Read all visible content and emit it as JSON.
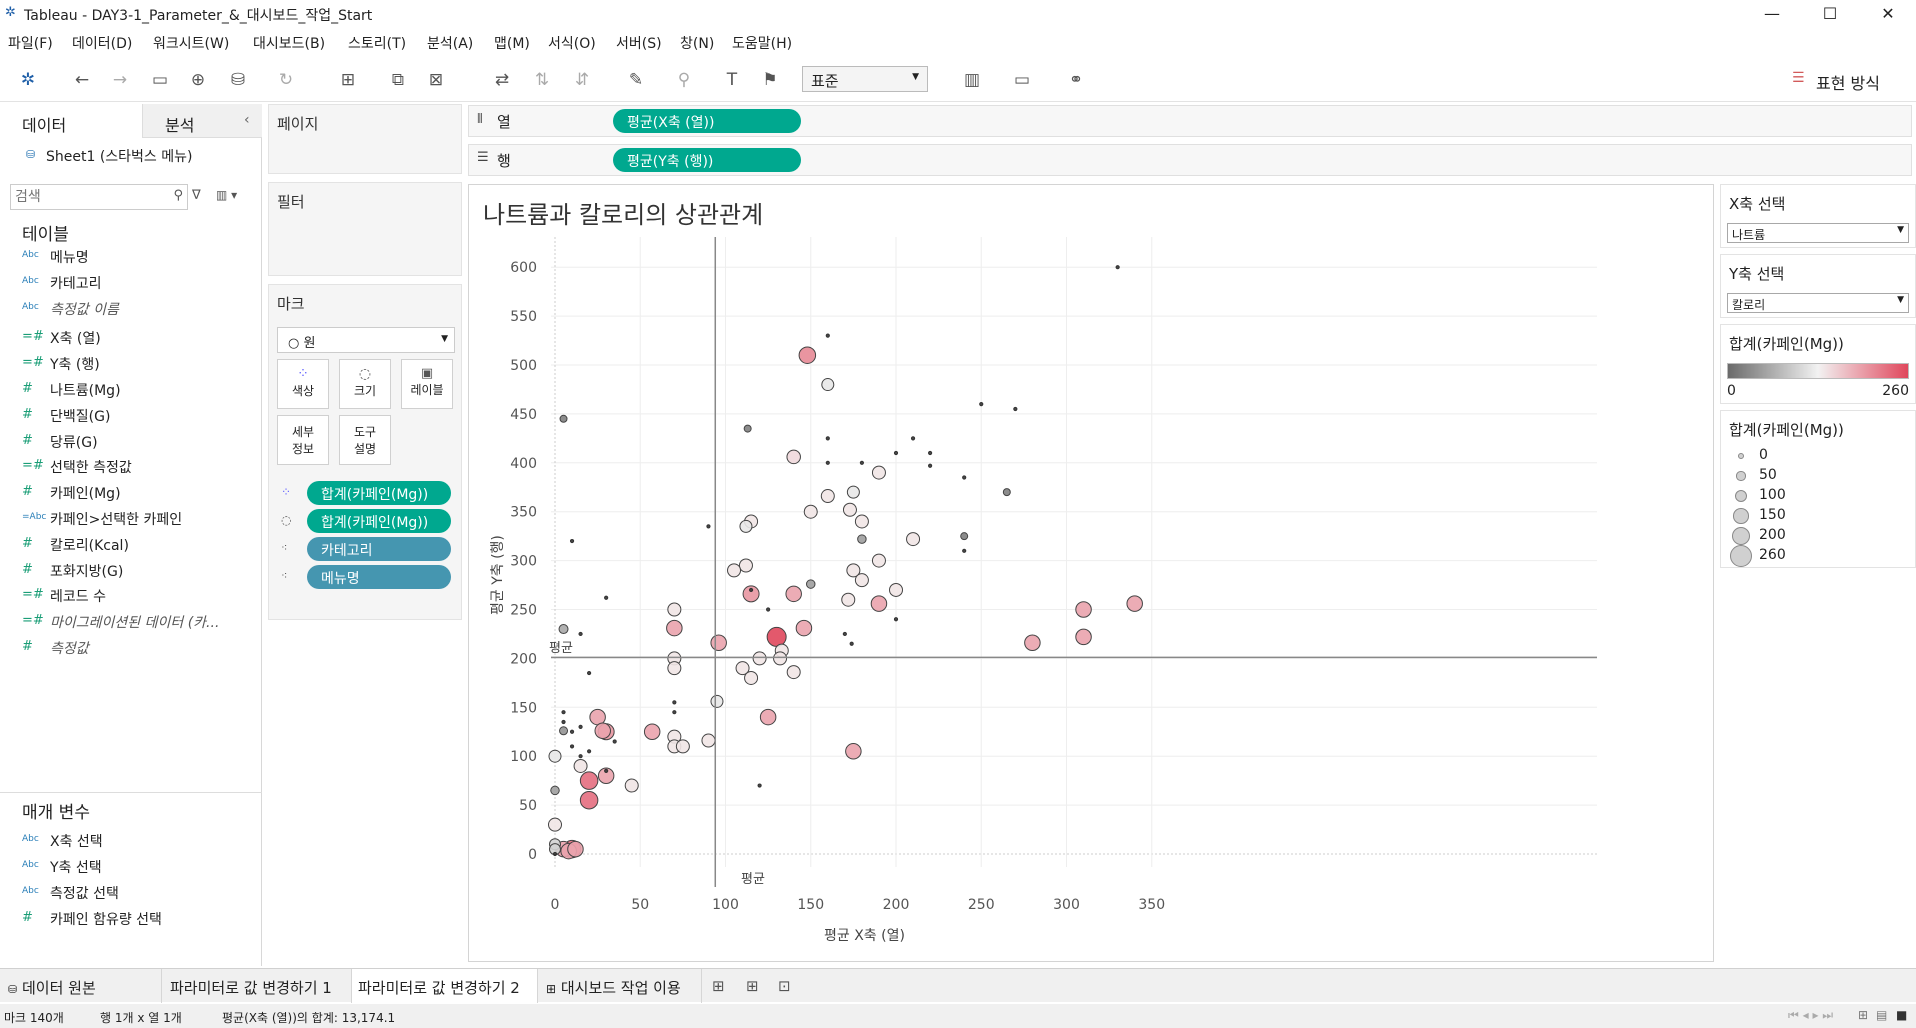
{
  "window": {
    "title": "Tableau - DAY3-1_Parameter_&_대시보드_작업_Start",
    "minimize_glyph": "—",
    "maximize_glyph": "☐",
    "close_glyph": "✕"
  },
  "menu": [
    "파일(F)",
    "데이터(D)",
    "워크시트(W)",
    "대시보드(B)",
    "스토리(T)",
    "분석(A)",
    "맵(M)",
    "서식(O)",
    "서버(S)",
    "창(N)",
    "도움말(H)"
  ],
  "toolbar": {
    "fit_value": "표준",
    "show_me_label": "표현 방식"
  },
  "sidebar": {
    "tab_data": "데이터",
    "tab_analysis": "분석",
    "datasource": "Sheet1 (스타벅스 메뉴)",
    "search_placeholder": "검색",
    "tables_title": "테이블",
    "fields": [
      {
        "type": "Abc",
        "label": "메뉴명",
        "italic": false
      },
      {
        "type": "Abc",
        "label": "카테고리",
        "italic": false
      },
      {
        "type": "Abc",
        "label": "측정값 이름",
        "italic": true
      },
      {
        "type": "=#",
        "label": "X축 (열)",
        "italic": false
      },
      {
        "type": "=#",
        "label": "Y축 (행)",
        "italic": false
      },
      {
        "type": "#",
        "label": "나트륨(Mg)",
        "italic": false
      },
      {
        "type": "#",
        "label": "단백질(G)",
        "italic": false
      },
      {
        "type": "#",
        "label": "당류(G)",
        "italic": false
      },
      {
        "type": "=#",
        "label": "선택한 측정값",
        "italic": false
      },
      {
        "type": "#",
        "label": "카페인(Mg)",
        "italic": false
      },
      {
        "type": "=Abc",
        "label": "카페인>선택한 카페인",
        "italic": false
      },
      {
        "type": "#",
        "label": "칼로리(Kcal)",
        "italic": false
      },
      {
        "type": "#",
        "label": "포화지방(G)",
        "italic": false
      },
      {
        "type": "=#",
        "label": "레코드 수",
        "italic": false
      },
      {
        "type": "=#",
        "label": "마이그레이션된 데이터 (카...",
        "italic": true
      },
      {
        "type": "#",
        "label": "측정값",
        "italic": true
      }
    ],
    "params_title": "매개 변수",
    "params": [
      {
        "type": "Abc",
        "label": "X축 선택"
      },
      {
        "type": "Abc",
        "label": "Y축 선택"
      },
      {
        "type": "Abc",
        "label": "측정값 선택"
      },
      {
        "type": "#",
        "label": "카페인 함유량 선택"
      }
    ]
  },
  "shelves": {
    "pages": "페이지",
    "filters": "필터",
    "marks": "마크",
    "mark_type": "○ 원",
    "mark_buttons": [
      {
        "name": "color",
        "label": "색상"
      },
      {
        "name": "size",
        "label": "크기"
      },
      {
        "name": "label",
        "label": "레이블"
      },
      {
        "name": "detail",
        "label": "세부\n정보"
      },
      {
        "name": "tooltip",
        "label": "도구\n설명"
      }
    ],
    "mark_pills": [
      "합계(카페인(Mg))",
      "합계(카페인(Mg))",
      "카테고리",
      "메뉴명"
    ],
    "columns_label": "열",
    "rows_label": "행",
    "columns_pill": "평균(X축 (열))",
    "rows_pill": "평균(Y축 (행))"
  },
  "view": {
    "title": "나트륨과 칼로리의 상관관계",
    "avg_label_h": "평균",
    "avg_label_v": "평균"
  },
  "right_panel": {
    "x_param_title": "X축 선택",
    "x_param_value": "나트륨",
    "y_param_title": "Y축 선택",
    "y_param_value": "칼로리",
    "color_legend_title": "합계(카페인(Mg))",
    "color_min": "0",
    "color_max": "260",
    "size_legend_title": "합계(카페인(Mg))",
    "size_items": [
      "0",
      "50",
      "100",
      "150",
      "200",
      "260"
    ],
    "colors": {
      "low": "#6a6a6a",
      "mid": "#f2f2f2",
      "high": "#e0475c"
    }
  },
  "bottom_tabs": [
    "데이터 원본",
    "파라미터로 값 변경하기 1",
    "파라미터로 값 변경하기 2",
    "대시보드 작업 이용"
  ],
  "status": {
    "marks": "마크 140개",
    "rows_cols": "행 1개 x 열 1개",
    "sum": "평균(X축 (열))의 합계: 13,174.1"
  },
  "chart_data": {
    "type": "scatter",
    "title": "나트륨과 칼로리의 상관관계",
    "xlabel": "평균 X축 (열)",
    "ylabel": "평균 Y축 (행)",
    "xlim": [
      -20,
      365
    ],
    "ylim": [
      -40,
      620
    ],
    "xticks": [
      0,
      50,
      100,
      150,
      200,
      250,
      300,
      350
    ],
    "yticks": [
      0,
      50,
      100,
      150,
      200,
      250,
      300,
      350,
      400,
      450,
      500,
      550,
      600
    ],
    "avg_x": 94,
    "avg_y": 201,
    "points": [
      {
        "x": 330,
        "y": 600,
        "c": 0
      },
      {
        "x": 160,
        "y": 530,
        "c": 0
      },
      {
        "x": 148,
        "y": 510,
        "c": 210
      },
      {
        "x": 160,
        "y": 480,
        "c": 120
      },
      {
        "x": 250,
        "y": 460,
        "c": 0
      },
      {
        "x": 270,
        "y": 455,
        "c": 0
      },
      {
        "x": 5,
        "y": 445,
        "c": 20
      },
      {
        "x": 113,
        "y": 435,
        "c": 20
      },
      {
        "x": 160,
        "y": 425,
        "c": 0
      },
      {
        "x": 210,
        "y": 425,
        "c": 0
      },
      {
        "x": 200,
        "y": 410,
        "c": 0
      },
      {
        "x": 220,
        "y": 410,
        "c": 0
      },
      {
        "x": 140,
        "y": 406,
        "c": 150
      },
      {
        "x": 160,
        "y": 400,
        "c": 0
      },
      {
        "x": 180,
        "y": 400,
        "c": 0
      },
      {
        "x": 220,
        "y": 397,
        "c": 0
      },
      {
        "x": 190,
        "y": 390,
        "c": 140
      },
      {
        "x": 240,
        "y": 385,
        "c": 0
      },
      {
        "x": 265,
        "y": 370,
        "c": 20
      },
      {
        "x": 175,
        "y": 370,
        "c": 120
      },
      {
        "x": 160,
        "y": 366,
        "c": 140
      },
      {
        "x": 150,
        "y": 350,
        "c": 140
      },
      {
        "x": 173,
        "y": 352,
        "c": 140
      },
      {
        "x": 115,
        "y": 340,
        "c": 140
      },
      {
        "x": 180,
        "y": 340,
        "c": 140
      },
      {
        "x": 112,
        "y": 335,
        "c": 120
      },
      {
        "x": 90,
        "y": 335,
        "c": 0
      },
      {
        "x": 240,
        "y": 325,
        "c": 20
      },
      {
        "x": 210,
        "y": 322,
        "c": 140
      },
      {
        "x": 180,
        "y": 322,
        "c": 50
      },
      {
        "x": 10,
        "y": 320,
        "c": 0
      },
      {
        "x": 240,
        "y": 310,
        "c": 0
      },
      {
        "x": 190,
        "y": 300,
        "c": 140
      },
      {
        "x": 112,
        "y": 295,
        "c": 140
      },
      {
        "x": 105,
        "y": 290,
        "c": 140
      },
      {
        "x": 175,
        "y": 290,
        "c": 140
      },
      {
        "x": 180,
        "y": 280,
        "c": 140
      },
      {
        "x": 150,
        "y": 276,
        "c": 50
      },
      {
        "x": 200,
        "y": 270,
        "c": 140
      },
      {
        "x": 115,
        "y": 270,
        "c": 0
      },
      {
        "x": 115,
        "y": 266,
        "c": 200
      },
      {
        "x": 140,
        "y": 266,
        "c": 190
      },
      {
        "x": 30,
        "y": 262,
        "c": 0
      },
      {
        "x": 172,
        "y": 260,
        "c": 140
      },
      {
        "x": 190,
        "y": 256,
        "c": 190
      },
      {
        "x": 125,
        "y": 250,
        "c": 0
      },
      {
        "x": 70,
        "y": 250,
        "c": 140
      },
      {
        "x": 310,
        "y": 250,
        "c": 190
      },
      {
        "x": 340,
        "y": 256,
        "c": 190
      },
      {
        "x": 200,
        "y": 240,
        "c": 0
      },
      {
        "x": 5,
        "y": 230,
        "c": 60
      },
      {
        "x": 70,
        "y": 231,
        "c": 190
      },
      {
        "x": 146,
        "y": 231,
        "c": 190
      },
      {
        "x": 15,
        "y": 225,
        "c": 0
      },
      {
        "x": 170,
        "y": 225,
        "c": 0
      },
      {
        "x": 130,
        "y": 222,
        "c": 260
      },
      {
        "x": 310,
        "y": 222,
        "c": 190
      },
      {
        "x": 96,
        "y": 216,
        "c": 190
      },
      {
        "x": 280,
        "y": 216,
        "c": 190
      },
      {
        "x": 174,
        "y": 215,
        "c": 0
      },
      {
        "x": 133,
        "y": 208,
        "c": 140
      },
      {
        "x": 132,
        "y": 200,
        "c": 140
      },
      {
        "x": 70,
        "y": 200,
        "c": 140
      },
      {
        "x": 120,
        "y": 200,
        "c": 140
      },
      {
        "x": 70,
        "y": 190,
        "c": 140
      },
      {
        "x": 110,
        "y": 190,
        "c": 140
      },
      {
        "x": 140,
        "y": 186,
        "c": 140
      },
      {
        "x": 20,
        "y": 185,
        "c": 0
      },
      {
        "x": 115,
        "y": 180,
        "c": 140
      },
      {
        "x": 95,
        "y": 156,
        "c": 120
      },
      {
        "x": 70,
        "y": 155,
        "c": 0
      },
      {
        "x": 70,
        "y": 145,
        "c": 0
      },
      {
        "x": 25,
        "y": 140,
        "c": 190
      },
      {
        "x": 125,
        "y": 140,
        "c": 190
      },
      {
        "x": 5,
        "y": 145,
        "c": 0
      },
      {
        "x": 5,
        "y": 135,
        "c": 0
      },
      {
        "x": 10,
        "y": 125,
        "c": 0
      },
      {
        "x": 5,
        "y": 126,
        "c": 40
      },
      {
        "x": 28,
        "y": 126,
        "c": 190
      },
      {
        "x": 30,
        "y": 125,
        "c": 200
      },
      {
        "x": 57,
        "y": 125,
        "c": 190
      },
      {
        "x": 15,
        "y": 130,
        "c": 0
      },
      {
        "x": 35,
        "y": 115,
        "c": 0
      },
      {
        "x": 70,
        "y": 120,
        "c": 140
      },
      {
        "x": 90,
        "y": 116,
        "c": 140
      },
      {
        "x": 70,
        "y": 110,
        "c": 140
      },
      {
        "x": 75,
        "y": 110,
        "c": 140
      },
      {
        "x": 10,
        "y": 110,
        "c": 0
      },
      {
        "x": 20,
        "y": 105,
        "c": 0
      },
      {
        "x": 175,
        "y": 105,
        "c": 190
      },
      {
        "x": 0,
        "y": 100,
        "c": 120
      },
      {
        "x": 15,
        "y": 100,
        "c": 0
      },
      {
        "x": 15,
        "y": 90,
        "c": 140
      },
      {
        "x": 30,
        "y": 85,
        "c": 0
      },
      {
        "x": 30,
        "y": 80,
        "c": 190
      },
      {
        "x": 20,
        "y": 75,
        "c": 230
      },
      {
        "x": 45,
        "y": 70,
        "c": 140
      },
      {
        "x": 120,
        "y": 70,
        "c": 0
      },
      {
        "x": 0,
        "y": 65,
        "c": 50
      },
      {
        "x": 20,
        "y": 55,
        "c": 230
      },
      {
        "x": 0,
        "y": 30,
        "c": 140
      },
      {
        "x": 0,
        "y": 10,
        "c": 100
      },
      {
        "x": 0,
        "y": 5,
        "c": 100
      },
      {
        "x": 5,
        "y": 5,
        "c": 190
      },
      {
        "x": 0,
        "y": 0,
        "c": 0
      },
      {
        "x": 8,
        "y": 3,
        "c": 190
      },
      {
        "x": 10,
        "y": 5,
        "c": 230
      },
      {
        "x": 12,
        "y": 5,
        "c": 190
      }
    ]
  }
}
